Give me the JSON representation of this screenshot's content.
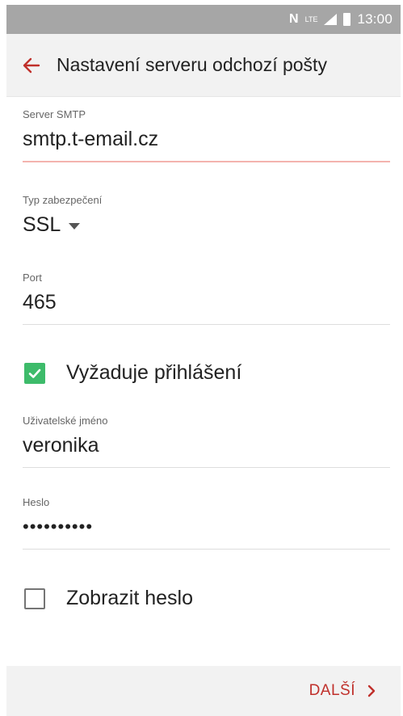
{
  "status_bar": {
    "time": "13:00",
    "icons": [
      "nfc-icon",
      "lte-icon",
      "signal-icon",
      "battery-icon"
    ],
    "nfc_text": "N",
    "lte_text": "LTE"
  },
  "header": {
    "back_icon": "arrow-left-icon",
    "title": "Nastavení serveru odchozí pošty"
  },
  "form": {
    "smtp_server": {
      "label": "Server SMTP",
      "value": "smtp.t-email.cz"
    },
    "security_type": {
      "label": "Typ zabezpečení",
      "value": "SSL"
    },
    "port": {
      "label": "Port",
      "value": "465"
    },
    "require_login": {
      "label": "Vyžaduje přihlášení",
      "checked": true
    },
    "username": {
      "label": "Uživatelské jméno",
      "value": "veronika"
    },
    "password": {
      "label": "Heslo",
      "value": "••••••••••"
    },
    "show_password": {
      "label": "Zobrazit heslo",
      "checked": false
    }
  },
  "footer": {
    "next_label": "DALŠÍ",
    "next_icon": "chevron-right-icon"
  },
  "colors": {
    "accent": "#c0302b",
    "checkbox": "#3dbb6a",
    "status_bar": "#a6a6a6",
    "app_bar": "#f2f2f2"
  }
}
